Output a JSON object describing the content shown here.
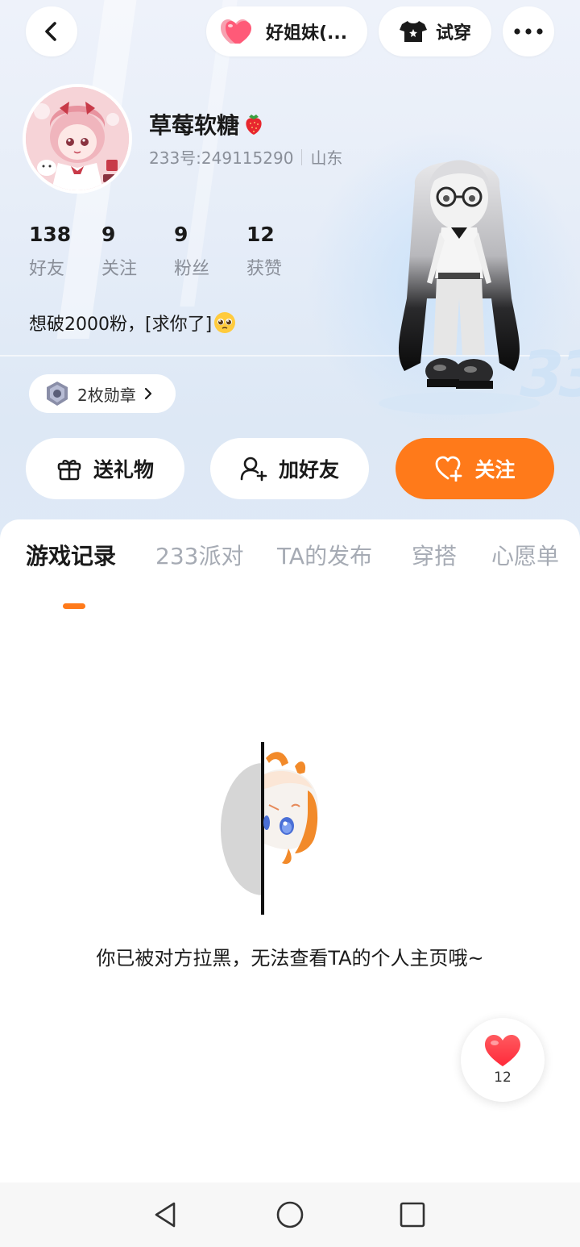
{
  "top_bar": {
    "back_icon": "chevron-left-icon",
    "relation_label": "好姐妹(...",
    "relation_icon": "pink-heart-icon",
    "tryon_label": "试穿",
    "tryon_icon": "tshirt-icon",
    "more_icon": "more-dots-icon"
  },
  "profile": {
    "nickname": "草莓软糖",
    "nickname_emoji": "🍓",
    "uid": "233号:249115290",
    "region": "山东",
    "stats": [
      {
        "value": "138",
        "label": "好友"
      },
      {
        "value": "9",
        "label": "关注"
      },
      {
        "value": "9",
        "label": "粉丝"
      },
      {
        "value": "12",
        "label": "获赞"
      }
    ],
    "bio": "想破2000粉，[求你了]",
    "bio_emoji": "🥺",
    "medals_label": "2枚勋章"
  },
  "actions": {
    "gift_label": "送礼物",
    "add_friend_label": "加好友",
    "follow_label": "关注"
  },
  "tabs": [
    {
      "label": "游戏记录",
      "active": true
    },
    {
      "label": "233派对",
      "active": false
    },
    {
      "label": "TA的发布",
      "active": false
    },
    {
      "label": "穿搭",
      "active": false
    },
    {
      "label": "心愿单",
      "active": false
    }
  ],
  "empty_state": {
    "message": "你已被对方拉黑，无法查看TA的个人主页哦~"
  },
  "like_fab": {
    "count": "12"
  },
  "colors": {
    "accent": "#ff7a1a",
    "heart": "#ff3b4f"
  }
}
